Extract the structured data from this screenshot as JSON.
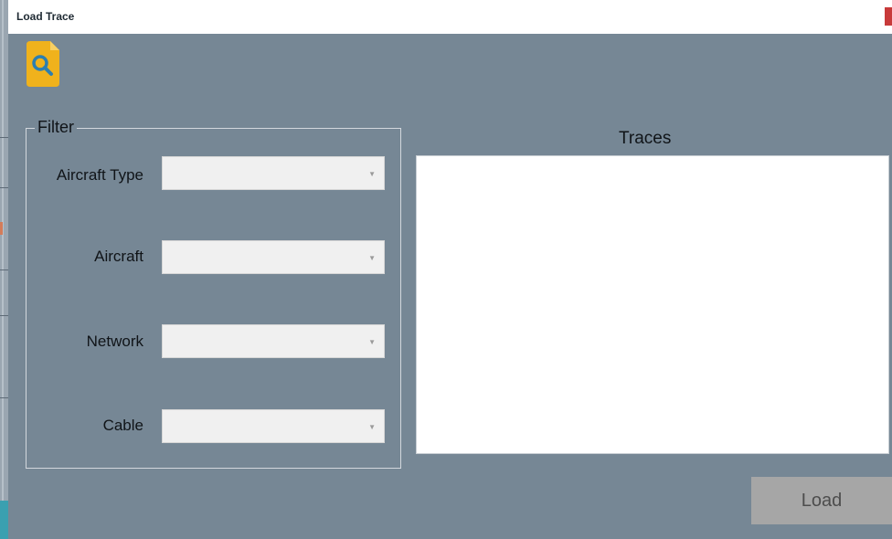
{
  "window": {
    "title": "Load Trace"
  },
  "toolbar": {
    "search_icon": "file-search-icon"
  },
  "filter": {
    "legend": "Filter",
    "fields": [
      {
        "label": "Aircraft Type",
        "value": ""
      },
      {
        "label": "Aircraft",
        "value": ""
      },
      {
        "label": "Network",
        "value": ""
      },
      {
        "label": "Cable",
        "value": ""
      }
    ]
  },
  "traces": {
    "label": "Traces",
    "items": []
  },
  "actions": {
    "load_label": "Load"
  },
  "colors": {
    "window_bg": "#768795",
    "list_bg": "#ffffff",
    "button_bg": "#a6a6a6",
    "icon_yellow": "#f0b21c",
    "icon_blue": "#2d7fb0"
  }
}
